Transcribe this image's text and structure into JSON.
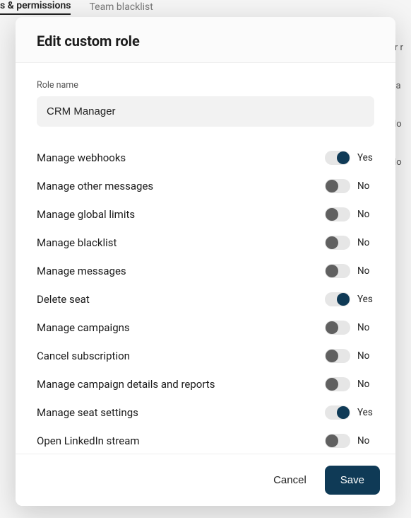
{
  "background": {
    "tabs": [
      "s & permissions",
      "Team blacklist"
    ],
    "rightHeader": "er r",
    "rightCells": [
      "Ca",
      "No",
      "No"
    ]
  },
  "modal": {
    "title": "Edit custom role",
    "roleNameLabel": "Role name",
    "roleNameValue": "CRM Manager",
    "toggleYes": "Yes",
    "toggleNo": "No",
    "cancelLabel": "Cancel",
    "saveLabel": "Save",
    "permissions": [
      {
        "label": "Manage webhooks",
        "enabled": true
      },
      {
        "label": "Manage other messages",
        "enabled": false
      },
      {
        "label": "Manage global limits",
        "enabled": false
      },
      {
        "label": "Manage blacklist",
        "enabled": false
      },
      {
        "label": "Manage messages",
        "enabled": false
      },
      {
        "label": "Delete seat",
        "enabled": true
      },
      {
        "label": "Manage campaigns",
        "enabled": false
      },
      {
        "label": "Cancel subscription",
        "enabled": false
      },
      {
        "label": "Manage campaign details and reports",
        "enabled": false
      },
      {
        "label": "Manage seat settings",
        "enabled": true
      },
      {
        "label": "Open LinkedIn stream",
        "enabled": false
      }
    ]
  }
}
